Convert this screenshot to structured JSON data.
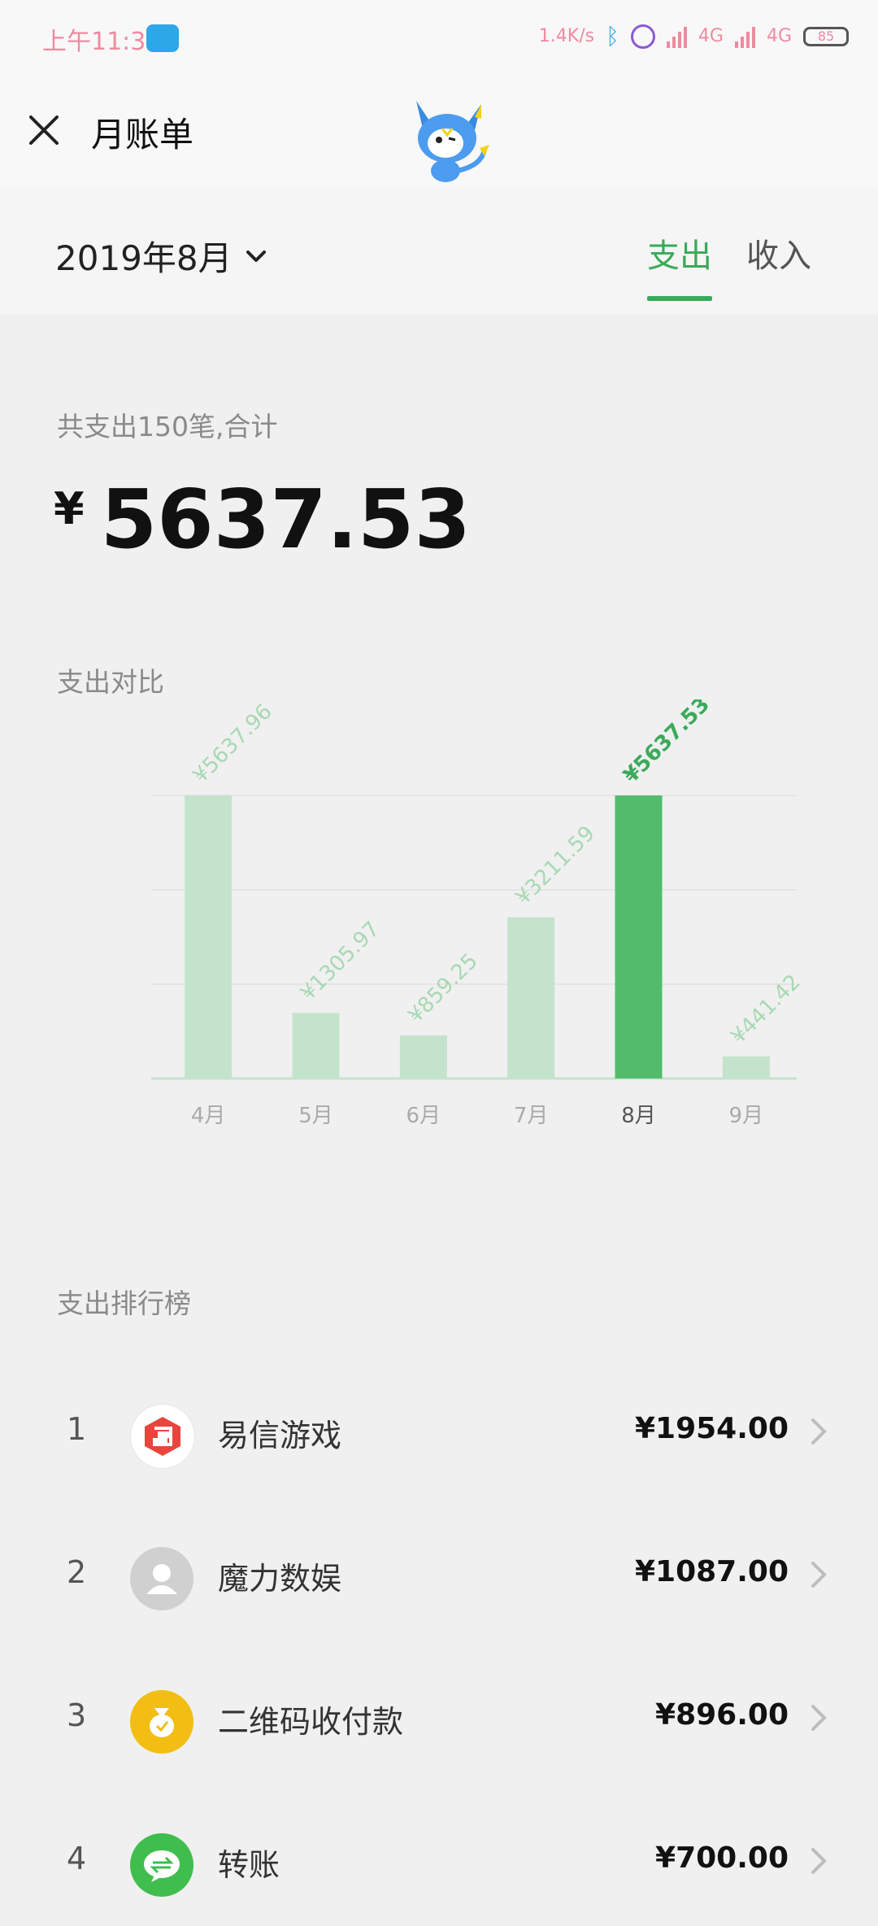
{
  "status_bar": {
    "time": "上午11:37",
    "net_speed": "1.4K/s",
    "network_1": "4G",
    "network_2": "4G",
    "battery": "85"
  },
  "header": {
    "title": "月账单"
  },
  "toolbar": {
    "month": "2019年8月",
    "tabs": [
      {
        "label": "支出",
        "active": true
      },
      {
        "label": "收入",
        "active": false
      }
    ]
  },
  "summary": {
    "label": "共支出150笔,合计",
    "currency": "¥",
    "total": "5637.53"
  },
  "comparison": {
    "title": "支出对比"
  },
  "chart_data": {
    "type": "bar",
    "categories": [
      "4月",
      "5月",
      "6月",
      "7月",
      "8月",
      "9月"
    ],
    "values": [
      5637.96,
      1305.97,
      859.25,
      3211.59,
      5637.53,
      441.42
    ],
    "value_labels": [
      "¥5637.96",
      "¥1305.97",
      "¥859.25",
      "¥3211.59",
      "¥5637.53",
      "¥441.42"
    ],
    "highlight_index": 4,
    "ylim": [
      0,
      5637.96
    ],
    "colors": {
      "normal": "#c4e3cc",
      "highlight": "#52bc6c",
      "label_normal": "#a8d8b4",
      "label_highlight": "#3aaa5a"
    }
  },
  "ranking": {
    "title": "支出排行榜",
    "items": [
      {
        "rank": "1",
        "name": "易信游戏",
        "amount": "¥1954.00",
        "icon": "yixin-game-icon",
        "color": "#e8453c"
      },
      {
        "rank": "2",
        "name": "魔力数娱",
        "amount": "¥1087.00",
        "icon": "default-user-icon",
        "color": "#d0d0d0"
      },
      {
        "rank": "3",
        "name": "二维码收付款",
        "amount": "¥896.00",
        "icon": "money-bag-icon",
        "color": "#f2be12"
      },
      {
        "rank": "4",
        "name": "转账",
        "amount": "¥700.00",
        "icon": "transfer-icon",
        "color": "#3fbe4d"
      }
    ]
  }
}
